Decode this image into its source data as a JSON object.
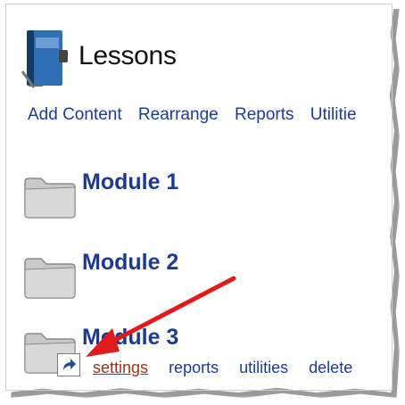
{
  "header": {
    "title": "Lessons"
  },
  "toolbar": {
    "items": [
      "Add Content",
      "Rearrange",
      "Reports",
      "Utilitie"
    ]
  },
  "modules": [
    {
      "title": "Module 1"
    },
    {
      "title": "Module 2"
    },
    {
      "title": "Module 3"
    }
  ],
  "module_actions": {
    "settings": "settings",
    "reports": "reports",
    "utilities": "utilities",
    "delete": "delete"
  },
  "colors": {
    "link": "#1f3c8f",
    "module_title": "#1e3a8f",
    "active_link": "#8b3a1a",
    "arrow": "#e11b1b"
  },
  "icons": {
    "header": "lessons-book-icon",
    "module": "folder-icon",
    "shortcut": "shortcut-arrow-icon"
  }
}
